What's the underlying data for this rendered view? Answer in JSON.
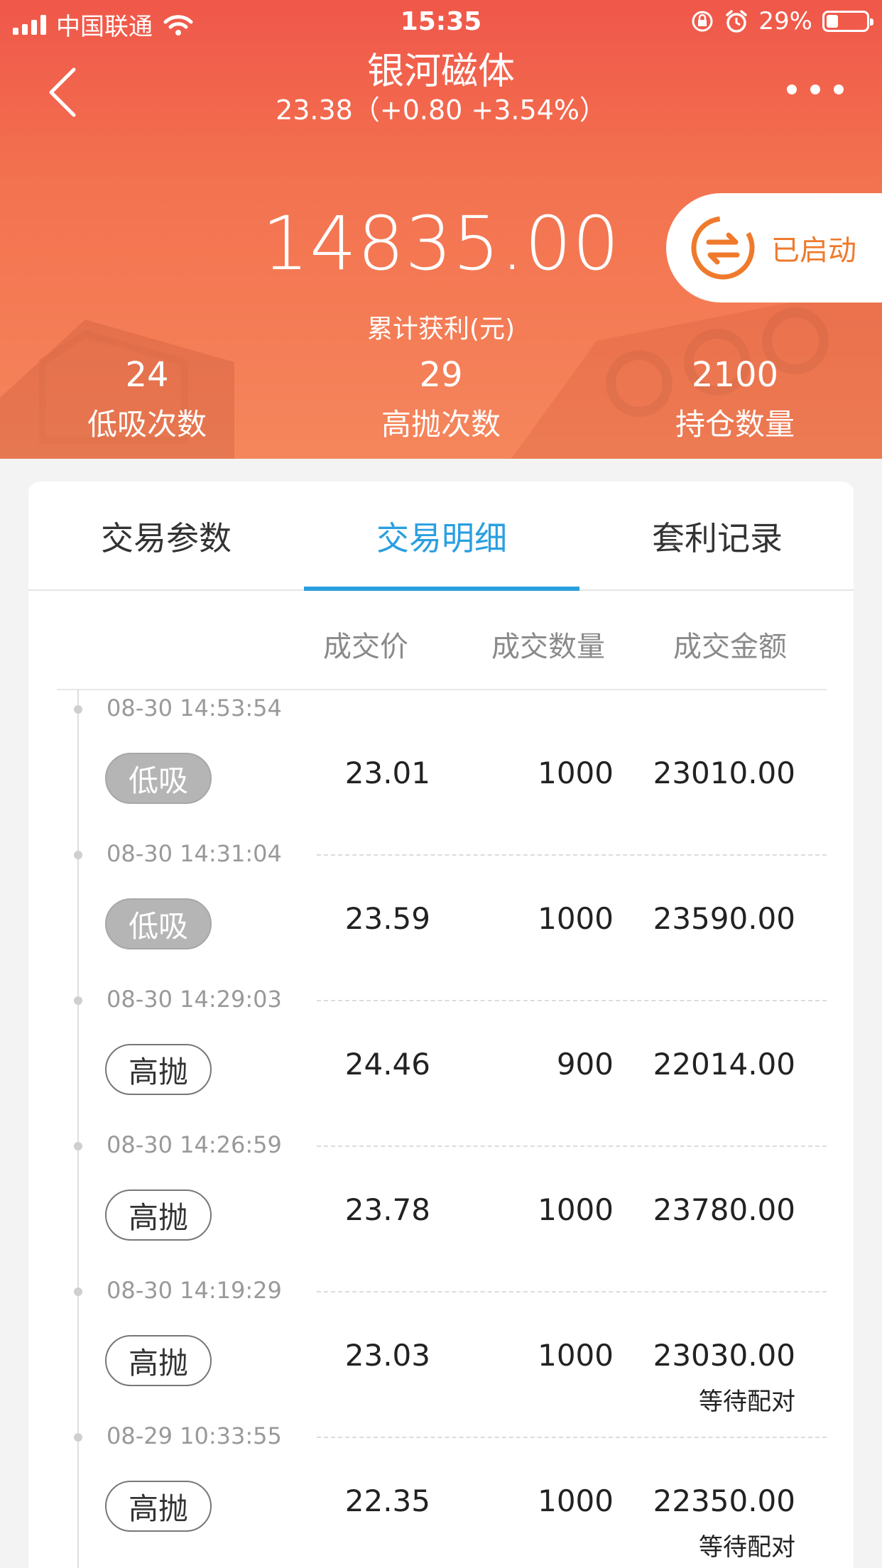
{
  "status_bar": {
    "carrier": "中国联通",
    "time": "15:35",
    "battery": "29%"
  },
  "nav": {
    "title": "银河磁体",
    "subtitle": "23.38（+0.80  +3.54%）"
  },
  "summary": {
    "profit": "14835.00",
    "profit_label": "累计获利(元)",
    "status": "已启动",
    "stats": [
      {
        "value": "24",
        "label": "低吸次数"
      },
      {
        "value": "29",
        "label": "高抛次数"
      },
      {
        "value": "2100",
        "label": "持仓数量"
      }
    ]
  },
  "tabs": [
    {
      "label": "交易参数",
      "active": false
    },
    {
      "label": "交易明细",
      "active": true
    },
    {
      "label": "套利记录",
      "active": false
    }
  ],
  "columns": [
    "成交价",
    "成交数量",
    "成交金额"
  ],
  "records": [
    {
      "time": "08-30 14:53:54",
      "type": "低吸",
      "kind": "buy",
      "price": "23.01",
      "qty": "1000",
      "amount": "23010.00",
      "note": ""
    },
    {
      "time": "08-30 14:31:04",
      "type": "低吸",
      "kind": "buy",
      "price": "23.59",
      "qty": "1000",
      "amount": "23590.00",
      "note": ""
    },
    {
      "time": "08-30 14:29:03",
      "type": "高抛",
      "kind": "sell",
      "price": "24.46",
      "qty": "900",
      "amount": "22014.00",
      "note": ""
    },
    {
      "time": "08-30 14:26:59",
      "type": "高抛",
      "kind": "sell",
      "price": "23.78",
      "qty": "1000",
      "amount": "23780.00",
      "note": ""
    },
    {
      "time": "08-30 14:19:29",
      "type": "高抛",
      "kind": "sell",
      "price": "23.03",
      "qty": "1000",
      "amount": "23030.00",
      "note": "等待配对"
    },
    {
      "time": "08-29 10:33:55",
      "type": "高抛",
      "kind": "sell",
      "price": "22.35",
      "qty": "1000",
      "amount": "22350.00",
      "note": "等待配对"
    }
  ]
}
